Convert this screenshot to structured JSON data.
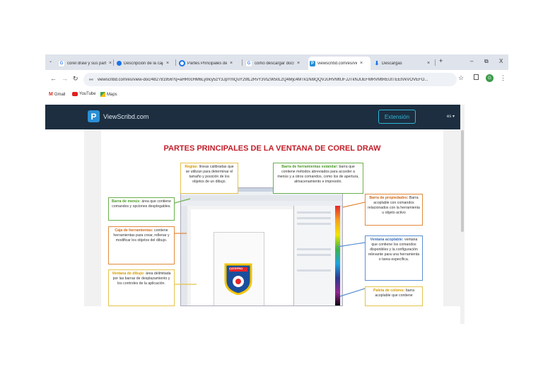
{
  "browser": {
    "tabs": [
      {
        "label": "corel draw y sus partes",
        "favicon": "google-icon",
        "active": false
      },
      {
        "label": "Descripción de la caja",
        "favicon": "blue-dot-icon",
        "active": false
      },
      {
        "label": "Partes Principales de la",
        "favicon": "chrome-icon",
        "active": false
      },
      {
        "label": "como descargar docs",
        "favicon": "google-icon",
        "active": false
      },
      {
        "label": "viewscribd.com/es/vie",
        "favicon": "viewscribd-icon",
        "active": true
      },
      {
        "label": "Descargas",
        "favicon": "download-icon",
        "active": false
      }
    ],
    "new_tab": "+",
    "window_controls": {
      "minimize": "–",
      "restore": "⧉",
      "close": "X"
    },
    "url": "viewscribd.com/es/view-doc/482781956?q=aHR0cHM6Ly9icy5zY3JpYmQuY29tL2RvY3VtZW50LzQ4Mjc4MTk1Ni9QQVJURVMtUFJJTkNJUEFMRVMtREUtTEEtVkVOVEFO...",
    "bookmarks": [
      {
        "label": "Gmail",
        "icon": "gmail-icon"
      },
      {
        "label": "YouTube",
        "icon": "youtube-icon"
      },
      {
        "label": "Maps",
        "icon": "maps-icon"
      }
    ]
  },
  "site": {
    "brand": "ViewScribd.com",
    "extension_button": "Extensión",
    "language": "es ▾"
  },
  "document": {
    "title": "PARTES PRINCIPALES DE LA VENTANA DE COREL DRAW",
    "callouts": {
      "reglas": {
        "key": "Reglas:",
        "text": "líneas calibradas que se utilizan para determinar el tamaño y posición de los objetos de un dibujo."
      },
      "barra_herramientas": {
        "key": "Barra de herramientas estándar:",
        "text": "barra que contiene métodos abreviados para acceder a menús y a otros comandos, como los de apertura, almacenamiento e impresión."
      },
      "barra_menus": {
        "key": "Barra de menús:",
        "text": "área que contiene comandos y opciones desplegables."
      },
      "barra_propiedades": {
        "key": "Barra de propiedades:",
        "text": "Barra acoplable con comandos relacionados con la herramienta u objeto activo"
      },
      "caja_herramientas": {
        "key": "Caja de herramientas:",
        "text": "contiene herramientas para crear, rellenar y modificar los objetos del dibujo."
      },
      "ventana_acoplable": {
        "key": "Ventana acoplable:",
        "text": "ventana que contiene los comandos disponibles y la configuración relevante para una herramienta o tarea específica."
      },
      "ventana_dibujo": {
        "key": "Ventana de dibujo:",
        "text": "área delimitada por las barras de desplazamiento y los controles de la aplicación."
      },
      "paleta_colores": {
        "key": "Paleta de colores:",
        "text": "barra acoplable que contiene"
      }
    },
    "emblem_text": "CATEPRO"
  },
  "colors": {
    "header_bg": "#1c2e40",
    "accent_cyan": "#2fb6d3",
    "title_red": "#c21f2a",
    "yellow_border": "#e5c34a",
    "green_border": "#6ab04c",
    "orange_border": "#e08a3c",
    "blue_border": "#5a8fd0"
  }
}
